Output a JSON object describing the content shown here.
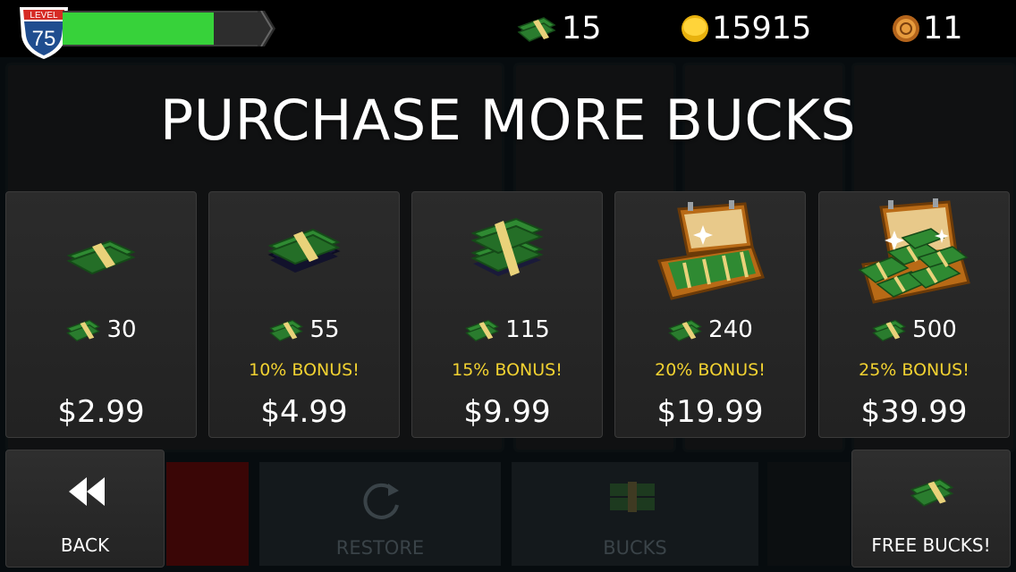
{
  "hud": {
    "level_label": "LEVEL",
    "level_value": "75",
    "xp_fraction": 0.76,
    "bucks_count": "15",
    "coins_count": "15915",
    "tokens_count": "11"
  },
  "title": "PURCHASE MORE BUCKS",
  "bundles": [
    {
      "amount": "30",
      "bonus": "",
      "price": "$2.99"
    },
    {
      "amount": "55",
      "bonus": "10% BONUS!",
      "price": "$4.99"
    },
    {
      "amount": "115",
      "bonus": "15% BONUS!",
      "price": "$9.99"
    },
    {
      "amount": "240",
      "bonus": "20% BONUS!",
      "price": "$19.99"
    },
    {
      "amount": "500",
      "bonus": "25% BONUS!",
      "price": "$39.99"
    }
  ],
  "background": {
    "restore_label": "RESTORE",
    "bucks_tab_label": "BUCKS"
  },
  "buttons": {
    "back_label": "BACK",
    "free_bucks_label": "FREE BUCKS!"
  },
  "colors": {
    "xp_fill": "#37d23a",
    "bonus_text": "#f2d231",
    "cash_green": "#2f8a32",
    "band_gold": "#e9d27a"
  },
  "icons": {
    "bucks": "cash-stack-icon",
    "coins": "gold-coin-icon",
    "tokens": "bronze-token-icon",
    "back": "double-chevron-left-icon",
    "restore": "refresh-icon"
  }
}
